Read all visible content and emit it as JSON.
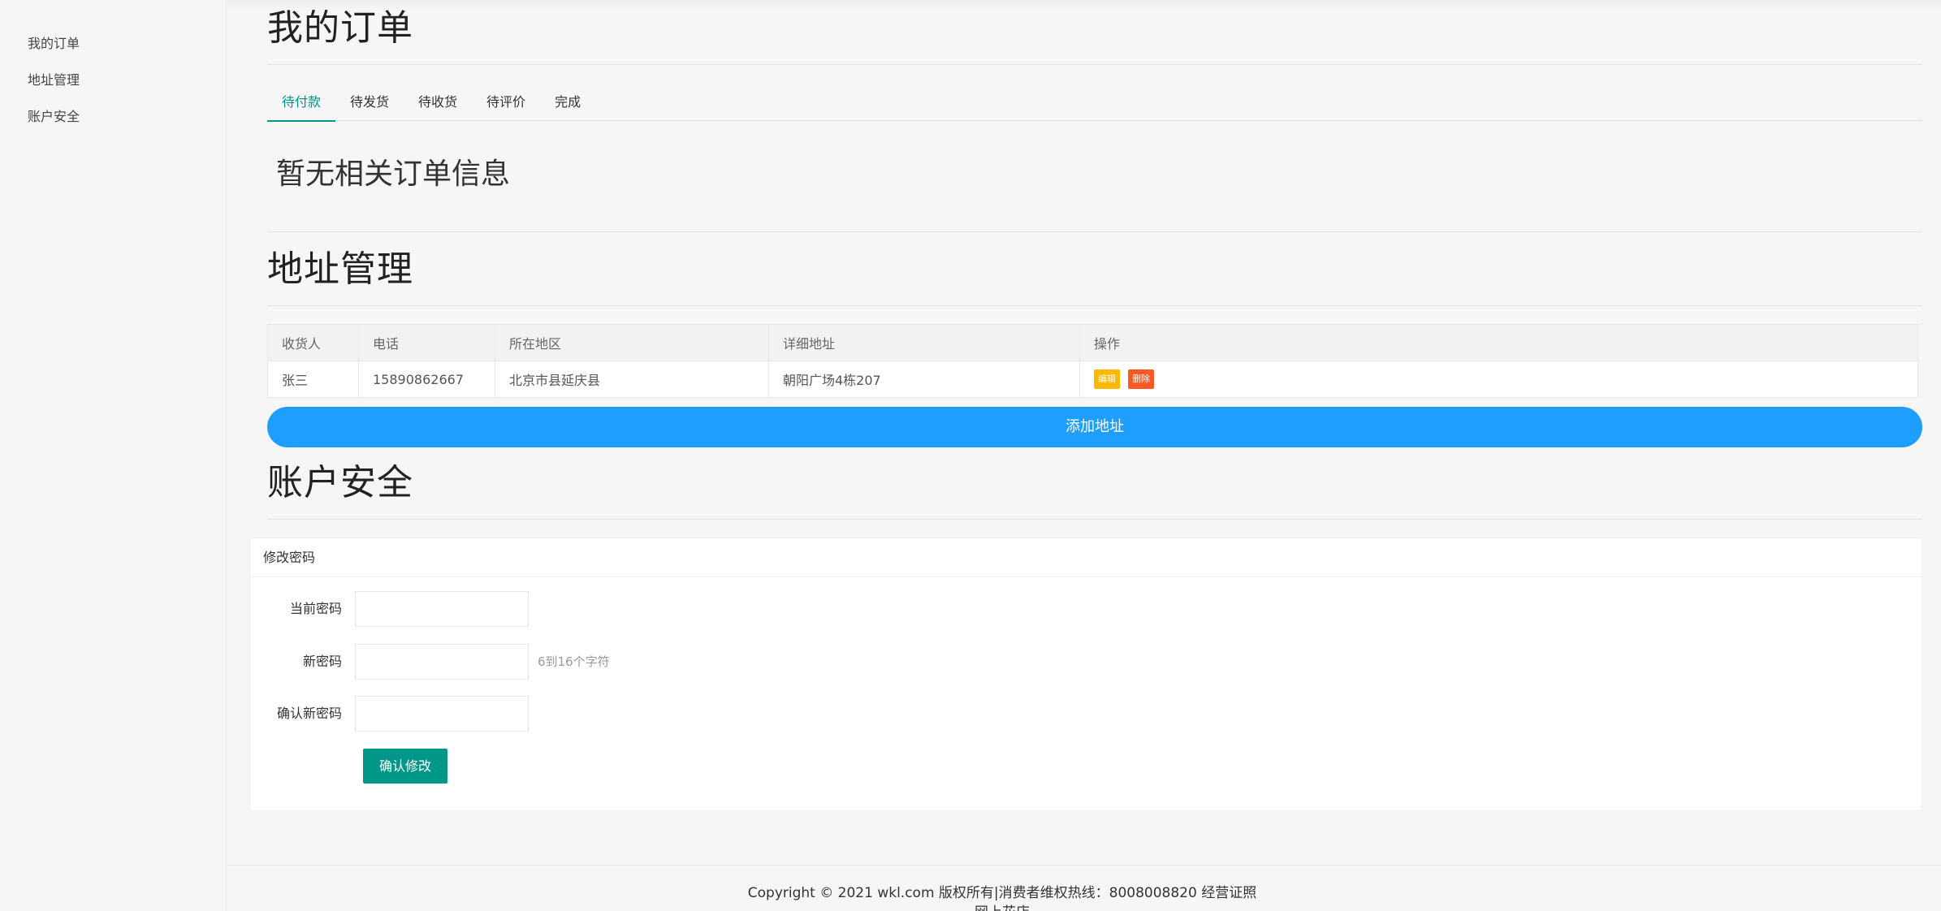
{
  "sidebar": {
    "items": [
      {
        "label": "我的订单"
      },
      {
        "label": "地址管理"
      },
      {
        "label": "账户安全"
      }
    ]
  },
  "orders": {
    "title": "我的订单",
    "tabs": [
      {
        "label": "待付款",
        "active": true
      },
      {
        "label": "待发货"
      },
      {
        "label": "待收货"
      },
      {
        "label": "待评价"
      },
      {
        "label": "完成"
      }
    ],
    "empty_message": "暂无相关订单信息"
  },
  "address": {
    "title": "地址管理",
    "columns": [
      "收货人",
      "电话",
      "所在地区",
      "详细地址",
      "操作"
    ],
    "rows": [
      {
        "name": "张三",
        "phone": "15890862667",
        "region": "北京市县延庆县",
        "detail": "朝阳广场4栋207"
      }
    ],
    "edit_label": "编辑",
    "delete_label": "删除",
    "add_label": "添加地址"
  },
  "security": {
    "title": "账户安全",
    "card_title": "修改密码",
    "current_label": "当前密码",
    "new_label": "新密码",
    "new_hint": "6到16个字符",
    "confirm_label": "确认新密码",
    "submit_label": "确认修改"
  },
  "footer": {
    "copyright": "Copyright © 2021 wkl.com 版权所有|消费者维权热线：8008008820 经营证照",
    "sub": "网上花店"
  },
  "colors": {
    "accent": "#009688",
    "primary_blue": "#1e9fff",
    "warn": "#ffb800",
    "danger": "#ff5722"
  }
}
